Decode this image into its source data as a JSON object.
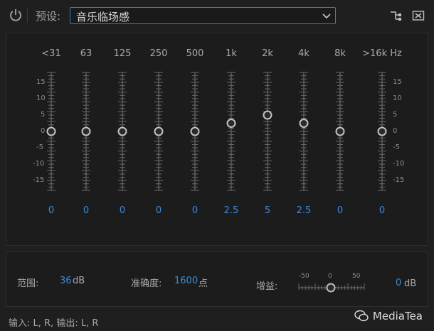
{
  "toolbar": {
    "preset_label": "预设:",
    "preset_value": "音乐临场感",
    "power_icon": "power-icon",
    "route_icon": "route-icon",
    "close_icon": "close-icon"
  },
  "eq": {
    "bands": [
      {
        "label": "<31",
        "value": "0"
      },
      {
        "label": "63",
        "value": "0"
      },
      {
        "label": "125",
        "value": "0"
      },
      {
        "label": "250",
        "value": "0"
      },
      {
        "label": "500",
        "value": "0"
      },
      {
        "label": "1k",
        "value": "2.5"
      },
      {
        "label": "2k",
        "value": "5"
      },
      {
        "label": "4k",
        "value": "2.5"
      },
      {
        "label": "8k",
        "value": "0"
      },
      {
        "label": ">16k Hz",
        "value": "0"
      }
    ],
    "scale_labels": [
      "15",
      "10",
      "5",
      "0",
      "-5",
      "-10",
      "-15"
    ],
    "db_range": [
      -18,
      18
    ]
  },
  "settings": {
    "range_label": "范围:",
    "range_value": "36",
    "range_unit": "dB",
    "accuracy_label": "准确度:",
    "accuracy_value": "1600",
    "accuracy_unit": "点",
    "gain_label": "增益:",
    "gain_scale": [
      "-50",
      "0",
      "50"
    ],
    "gain_value": "0",
    "gain_unit": "dB"
  },
  "footer": {
    "io_text": "输入: L, R,  输出: L, R",
    "watermark": "MediaTea"
  }
}
